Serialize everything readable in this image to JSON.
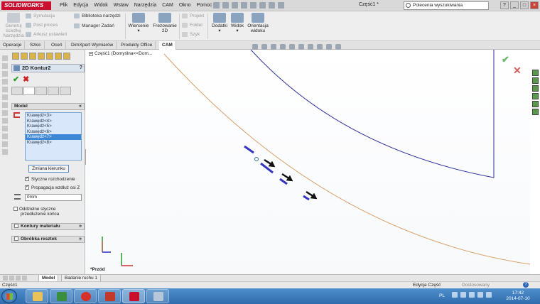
{
  "app": {
    "logo_text": "SOLIDWORKS",
    "document_title": "Część1 *",
    "menu": [
      "Plik",
      "Edycja",
      "Widok",
      "Wstaw",
      "Narzędzia",
      "CAM",
      "Okno",
      "Pomoc"
    ],
    "search_placeholder": "Polecenia wyszukiwania"
  },
  "ribbon": {
    "generuj_line1": "Generuj",
    "generuj_line2": "ścieżkę",
    "generuj_line3": "Narzędzia",
    "symulacja": "Symulacja",
    "post_proces": "Post proces",
    "arkusz": "Arkusz ustawień",
    "biblioteka": "Biblioteka narzędzi",
    "manager": "Manager Zadań",
    "wiercenie": "Wiercenie",
    "frezowanie_1": "Frezowanie",
    "frezowanie_2": "2D",
    "projekt": "Projekt",
    "folder": "Folder",
    "szyk": "Szyk",
    "dodatki": "Dodatki",
    "widok": "Widok",
    "orientacja_1": "Orientacja",
    "orientacja_2": "widoku"
  },
  "tabs": [
    "Operacje",
    "Szkic",
    "Oceń",
    "DimXpert Wymiarów",
    "Produkty Office",
    "CAM"
  ],
  "property_manager": {
    "title": "2D Kontur2",
    "help": "?",
    "model_group": "Model",
    "edges": [
      "Krawędź<3>",
      "Krawędź<4>",
      "Krawędź<5>",
      "Krawędź<6>",
      "Krawędź<7>",
      "Krawędź<8>"
    ],
    "selected_edge_index": 4,
    "change_direction": "Zmiana kierunku",
    "tangent_divergence": "Styczne rozchodzenie",
    "tangent_divergence_checked": true,
    "propagate_z": "Propagacja wzdłuż osi Z",
    "propagate_z_checked": true,
    "offset_value": "0mm",
    "separate_tangent_1": "Oddzielne styczne",
    "separate_tangent_2": "przedłużenie końca",
    "material_contours": "Kontury materiału",
    "residual_machining": "Obróbka resztek"
  },
  "viewport": {
    "tree_root": "Część1 (Domyślna<<Dom...",
    "view_label": "*Przód"
  },
  "model_tabs": [
    "Model",
    "Badanie ruchu 1"
  ],
  "status": {
    "left": "Część1",
    "mode": "Edycja Część",
    "units": "Dostosowany",
    "help": "?"
  },
  "taskbar": {
    "language": "PL",
    "time": "17:42",
    "date": "2014-07-10"
  },
  "colors": {
    "brand_red": "#c8102e",
    "arc_orange": "#d8a06a",
    "edge_blue": "#2f2f9c",
    "selection_blue": "#3c86d6"
  }
}
